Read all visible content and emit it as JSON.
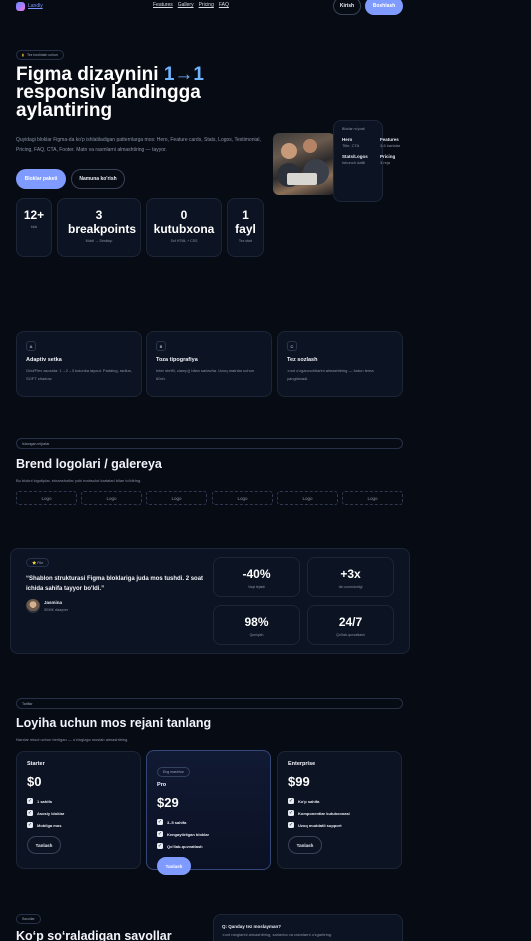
{
  "nav": {
    "brand": "Landly",
    "links": [
      "Features",
      "Gallery",
      "Pricing",
      "FAQ"
    ],
    "login": "Kirish",
    "signup": "Boshlash"
  },
  "hero": {
    "badge": "Tez boshlash uchun",
    "title_line1_a": "Figma dizaynini ",
    "title_line1_b": "1→1",
    "title_line2": "responsiv landingga",
    "title_line3": "aylantiring",
    "description": "Quyidagi bloklar Figma-da ko'p ishlatiladigan patternlarga mos: Hero, Feature cards, Stats, Logos, Testimonial, Pricing, FAQ, CTA, Footer. Matn va rasmlarni almashtiring — tayyor.",
    "cta_primary": "Bloklar paketi",
    "cta_secondary": "Namuna ko'rish",
    "stats": [
      {
        "value": "12+",
        "label": "blok"
      },
      {
        "value": "3 breakpoints",
        "label": "Mobil → Desktop"
      },
      {
        "value": "0 kutubxona",
        "label": "Sof HTML + CSS"
      },
      {
        "value": "1 fayl",
        "label": "Tez start"
      }
    ],
    "blocks_card": {
      "title": "Bloklar ro'yxati",
      "items": [
        {
          "name": "Hero",
          "sub": "Title, CTA"
        },
        {
          "name": "Features",
          "sub": "3-6 kartalar"
        },
        {
          "name": "Stats/Logos",
          "sub": "Ishonch dalili"
        },
        {
          "name": "Pricing",
          "sub": "3 reja"
        }
      ]
    }
  },
  "features": [
    {
      "badge": "A",
      "title": "Adaptiv setka",
      "desc": "Grid/Flex asosida: 1→2→3 kolonka layout. Padding, radius, SOFT shadow."
    },
    {
      "badge": "B",
      "title": "Toza tipografiya",
      "desc": "Inter shrifti, clamp() bilan sarlavha. Uzoq matnlar uchun 60ch."
    },
    {
      "badge": "C",
      "title": "Tez sozlash",
      "desc": ":root o'zgaruvchilarini almashtiring — butun tema yangilanadi."
    }
  ],
  "logos": {
    "chip": "Ishongan mijozlar",
    "title": "Brend logolari / galereya",
    "desc": "Bu blokni logotiplar, ekranshotlar yoki mahsulot kartalari bilan to'ldiring.",
    "items": [
      "Logo",
      "Logo",
      "Logo",
      "Logo",
      "Logo",
      "Logo"
    ]
  },
  "testimonial": {
    "chip": "⭐ Fikr",
    "quote": "“Shablon strukturasi Figma bloklariga juda mos tushdi. 2 soat ichida sahifa tayyor bo'ldi.”",
    "author": "Jasmina",
    "role": "SEMK dizayner",
    "metrics": [
      {
        "value": "-40%",
        "label": "Vaqt tejaldi"
      },
      {
        "value": "+3x",
        "label": "Ish unumdorligi"
      },
      {
        "value": "98%",
        "label": "Qoniqish"
      },
      {
        "value": "24/7",
        "label": "Qo'llab-quvvatlash"
      }
    ]
  },
  "pricing": {
    "chip": "Tariflar",
    "title": "Loyiha uchun mos rejani tanlang",
    "desc": "Narxlar misol uchun berilgan — o'zingizga moslab almashtiring.",
    "plans": [
      {
        "name": "Starter",
        "price": "$0",
        "features": [
          "1 sahifa",
          "Asosiy bloklar",
          "Mobilga mos"
        ],
        "button": "Tanlash",
        "popular": ""
      },
      {
        "name": "Pro",
        "price": "$29",
        "features": [
          "3–5 sahifa",
          "Kengaytirilgan bloklar",
          "Qo'llab-quvvatlash"
        ],
        "button": "Tanlash",
        "popular": "Eng mashhur"
      },
      {
        "name": "Enterprise",
        "price": "$99",
        "features": [
          "Ko'p sahifa",
          "Komponentlar kutubxonasi",
          "Uzoq muddatli support"
        ],
        "button": "Tanlash",
        "popular": ""
      }
    ]
  },
  "faq": {
    "chip": "Savollar",
    "title": "Ko‘p so‘raladigan savollar",
    "question": "Q: Qanday tez moslayman?",
    "answer": ":root ranglarini almashtiring, sarlavha va rasmlarni o'zgartiring."
  }
}
